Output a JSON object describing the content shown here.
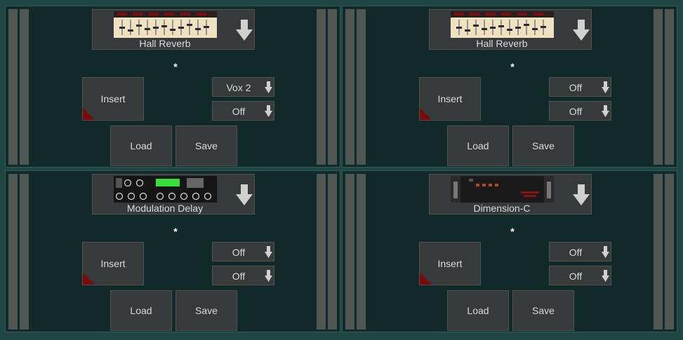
{
  "panels": [
    {
      "plugin_name": "Hall Reverb",
      "asterisk": "*",
      "insert_label": "Insert",
      "dropdown1": "Vox 2",
      "dropdown2": "Off",
      "load_label": "Load",
      "save_label": "Save",
      "thumbnail": "eq-faders"
    },
    {
      "plugin_name": "Hall Reverb",
      "asterisk": "*",
      "insert_label": "Insert",
      "dropdown1": "Off",
      "dropdown2": "Off",
      "load_label": "Load",
      "save_label": "Save",
      "thumbnail": "eq-faders"
    },
    {
      "plugin_name": "Modulation Delay",
      "asterisk": "*",
      "insert_label": "Insert",
      "dropdown1": "Off",
      "dropdown2": "Off",
      "load_label": "Load",
      "save_label": "Save",
      "thumbnail": "delay-knobs"
    },
    {
      "plugin_name": "Dimension-C",
      "asterisk": "*",
      "insert_label": "Insert",
      "dropdown1": "Off",
      "dropdown2": "Off",
      "load_label": "Load",
      "save_label": "Save",
      "thumbnail": "dimension-c-rack"
    }
  ],
  "colors": {
    "background": "#1f4640",
    "panel": "#112a29",
    "button": "#363a3b",
    "text": "#d9dcdb",
    "corner_mark": "#7a0a0a",
    "delay_display": "#39e03c"
  }
}
